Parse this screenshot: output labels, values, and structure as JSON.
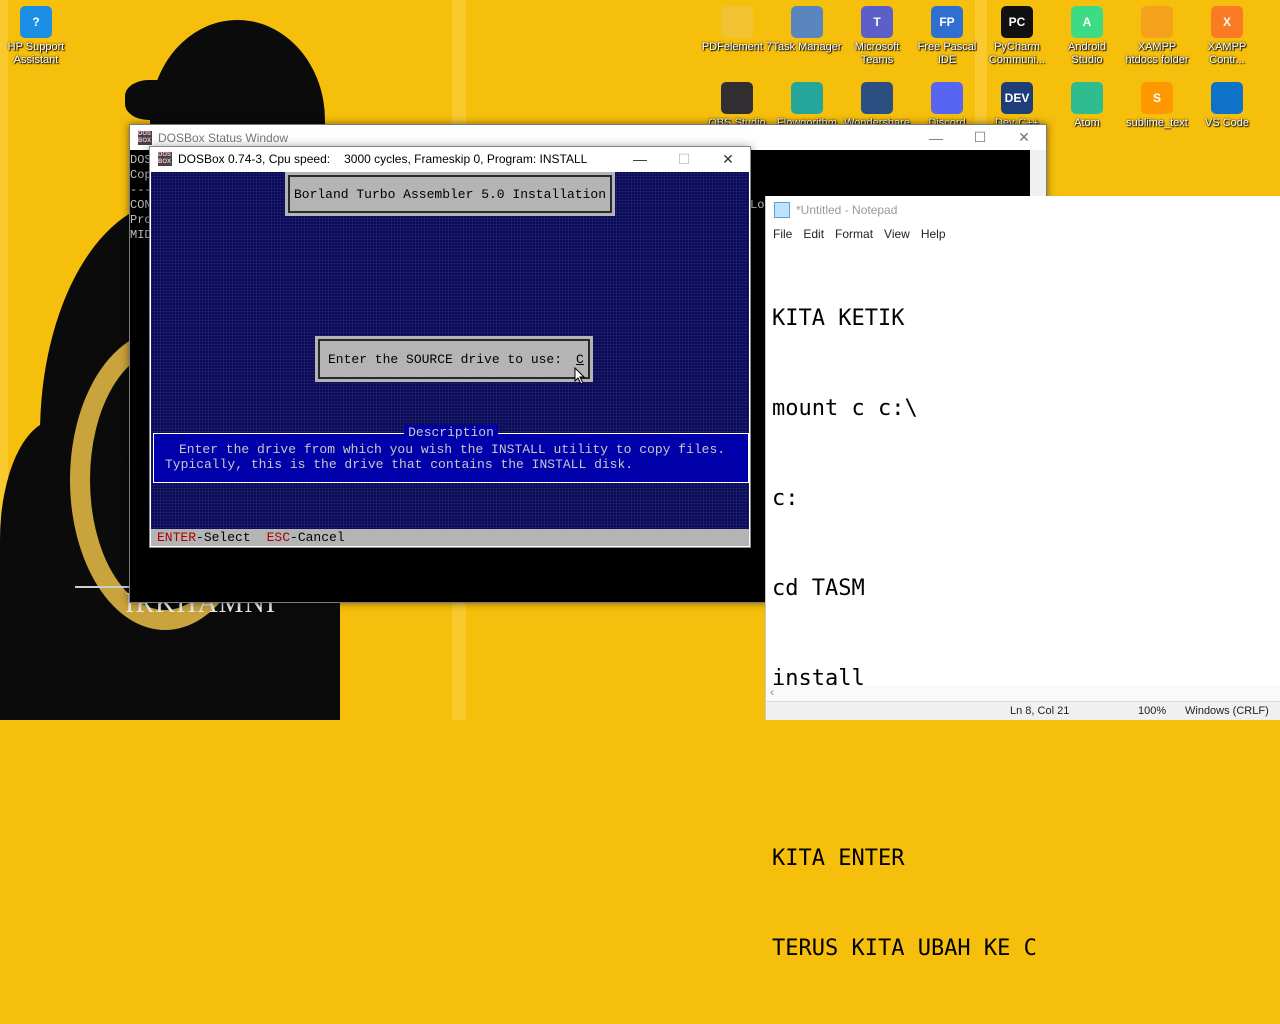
{
  "desktop": {
    "icons": [
      {
        "label": "HP Support Assistant",
        "glyph": "?",
        "color": "#1a8fe3"
      },
      {
        "label": "PDFelement 7",
        "glyph": "",
        "color": "#f1c232"
      },
      {
        "label": "Task Manager",
        "glyph": "",
        "color": "#5a86c0"
      },
      {
        "label": "Microsoft Teams",
        "glyph": "T",
        "color": "#5b5fc7"
      },
      {
        "label": "Free Pascal IDE",
        "glyph": "FP",
        "color": "#2f6fd0"
      },
      {
        "label": "PyCharm Communi...",
        "glyph": "PC",
        "color": "#111111"
      },
      {
        "label": "Android Studio",
        "glyph": "A",
        "color": "#3ddc84"
      },
      {
        "label": "XAMPP htdocs folder",
        "glyph": "",
        "color": "#f4a21b"
      },
      {
        "label": "XAMPP Contr...",
        "glyph": "X",
        "color": "#fb7a24"
      },
      {
        "label": "OBS Studio",
        "glyph": "",
        "color": "#302e31"
      },
      {
        "label": "Flowgorithm",
        "glyph": "",
        "color": "#26a69a"
      },
      {
        "label": "Wondershare",
        "glyph": "",
        "color": "#2b4f81"
      },
      {
        "label": "Discord",
        "glyph": "",
        "color": "#5865f2"
      },
      {
        "label": "Dev-C++",
        "glyph": "DEV",
        "color": "#1e3e7a"
      },
      {
        "label": "Atom",
        "glyph": "",
        "color": "#2ebd8f"
      },
      {
        "label": "sublime_text",
        "glyph": "S",
        "color": "#ff9800"
      },
      {
        "label": "VS Code",
        "glyph": "",
        "color": "#0e73c8"
      }
    ],
    "watermark": "IRKHAMNI"
  },
  "status_window": {
    "title": "DOSBox Status Window",
    "lines": [
      "DOS",
      "Cop",
      "---",
      "CON",
      "Pro",
      "MID"
    ],
    "right_fragment": "Loc"
  },
  "dosbox": {
    "title_app": "DOSBox 0.74-3, Cpu speed:",
    "title_info": "3000 cycles, Frameskip  0, Program:  INSTALL",
    "header": "Borland Turbo Assembler 5.0 Installation",
    "prompt": "Enter the SOURCE drive to use:",
    "drive_value": "C",
    "description_title": "Description",
    "description_line1": "Enter the drive from which you wish the INSTALL utility to copy files.",
    "description_line2": "Typically, this is the drive that contains the INSTALL disk.",
    "enter_key": "ENTER",
    "enter_action": "-Select",
    "esc_key": "ESC",
    "esc_action": "-Cancel"
  },
  "notepad": {
    "title": "*Untitled - Notepad",
    "menu": [
      "File",
      "Edit",
      "Format",
      "View",
      "Help"
    ],
    "lines": [
      "KITA KETIK",
      "mount c c:\\",
      "c:",
      "cd TASM",
      "install",
      "",
      "KITA ENTER",
      "TERUS KITA UBAH KE C"
    ],
    "position": "Ln 8, Col 21",
    "zoom": "100%",
    "encoding": "Windows (CRLF)"
  }
}
